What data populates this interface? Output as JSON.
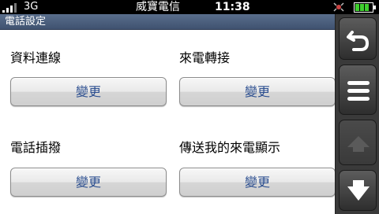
{
  "status_bar": {
    "network_type": "3G",
    "carrier": "威寶電信",
    "time": "11:38",
    "icons": [
      "signal-icon",
      "gps-icon",
      "battery-icon"
    ]
  },
  "title_bar": {
    "title": "電話設定"
  },
  "settings": [
    {
      "label": "資料連線",
      "button_label": "變更"
    },
    {
      "label": "來電轉接",
      "button_label": "變更"
    },
    {
      "label": "電話插撥",
      "button_label": "變更"
    },
    {
      "label": "傳送我的來電顯示",
      "button_label": "變更"
    }
  ],
  "side_panel": {
    "buttons": [
      {
        "icon": "back-icon",
        "enabled": true
      },
      {
        "icon": "menu-icon",
        "enabled": true
      },
      {
        "icon": "arrow-up-icon",
        "enabled": false
      },
      {
        "icon": "arrow-down-icon",
        "enabled": true
      }
    ]
  },
  "colors": {
    "title_bar": "#4a5d7e",
    "button_text": "#2a4d8f",
    "battery": "#3fcf2f"
  }
}
